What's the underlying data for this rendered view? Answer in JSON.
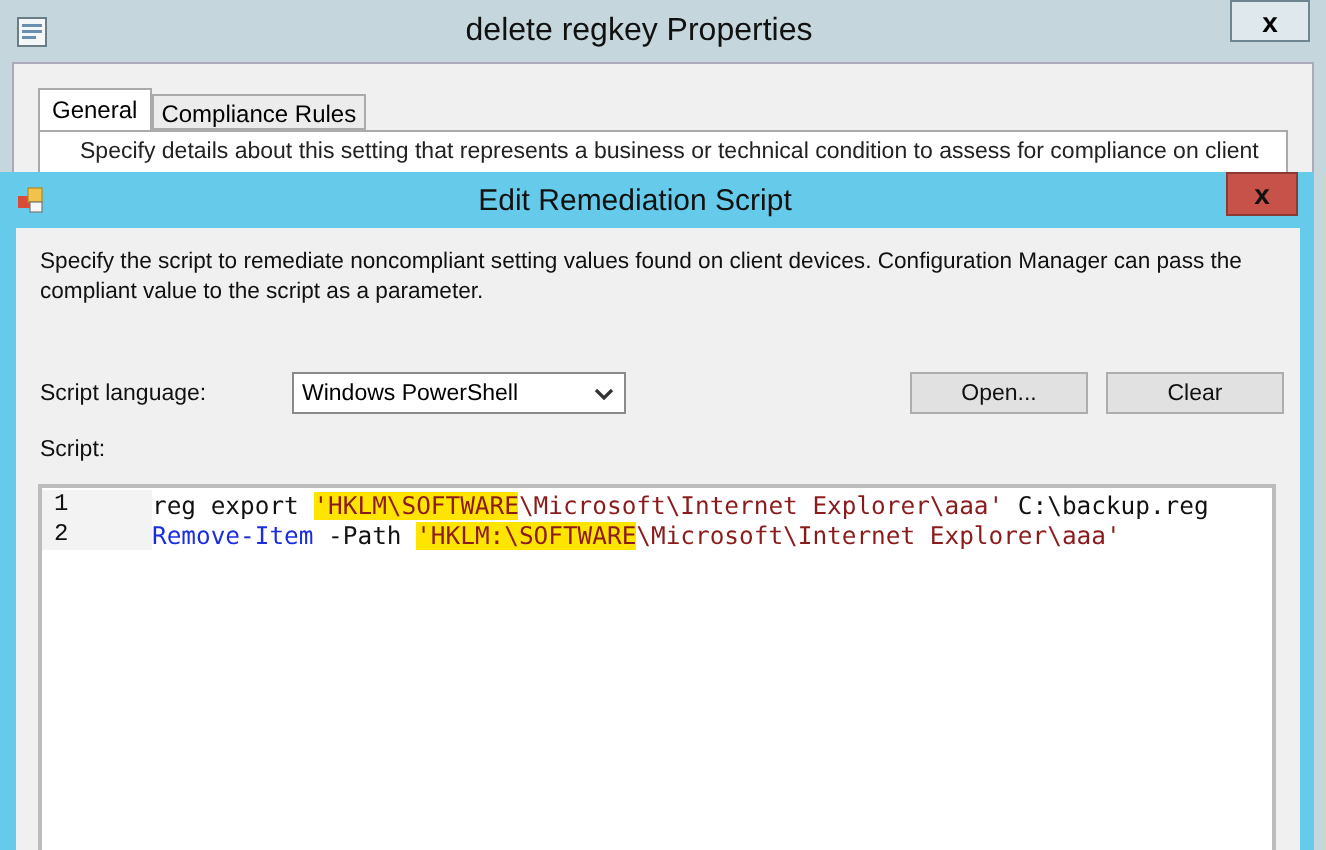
{
  "main_window": {
    "title": "delete regkey Properties",
    "close": "x",
    "tabs": [
      {
        "label": "General",
        "selected": true
      },
      {
        "label": "Compliance Rules",
        "selected": false
      }
    ],
    "description": "Specify details about this setting that represents a business or technical condition to assess for compliance on client"
  },
  "dialog": {
    "title": "Edit Remediation Script",
    "close": "x",
    "description": "Specify the script to remediate noncompliant setting values found on client devices. Configuration Manager can pass the compliant value to the script as a parameter.",
    "language_label": "Script language:",
    "language_value": "Windows PowerShell",
    "buttons": [
      "Open...",
      "Clear"
    ],
    "script_label": "Script:",
    "lines": [
      {
        "number": "1",
        "tokens": [
          {
            "kind": "plain",
            "text": "reg export ",
            "highlighted": false
          },
          {
            "kind": "string",
            "text": "'HKLM\\SOFTWARE",
            "highlighted": true
          },
          {
            "kind": "string",
            "text": "\\Microsoft\\Internet Explorer\\aaa'",
            "highlighted": false
          },
          {
            "kind": "plain",
            "text": " C:\\backup.reg",
            "highlighted": false
          }
        ]
      },
      {
        "number": "2",
        "tokens": [
          {
            "kind": "keyword",
            "text": "Remove-Item",
            "highlighted": false
          },
          {
            "kind": "plain",
            "text": " -Path ",
            "highlighted": false
          },
          {
            "kind": "string",
            "text": "'HKLM:\\SOFTWARE",
            "highlighted": true
          },
          {
            "kind": "string",
            "text": "\\Microsoft\\Internet Explorer\\aaa'",
            "highlighted": false
          }
        ]
      }
    ]
  }
}
